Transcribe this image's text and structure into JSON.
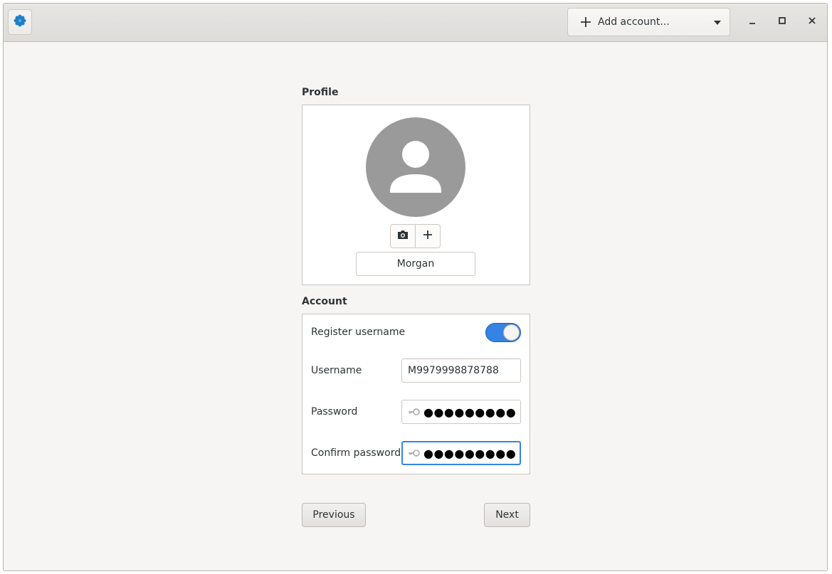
{
  "header": {
    "add_account_label": "Add account...",
    "icons": {
      "app": "app-cog-icon",
      "add": "plus-icon",
      "dropdown": "chevron-down-icon",
      "minimize": "minimize-icon",
      "maximize": "maximize-icon",
      "close": "close-icon"
    }
  },
  "profile": {
    "section_title": "Profile",
    "name_value": "Morgan",
    "icons": {
      "avatar": "user-icon",
      "camera": "camera-icon",
      "add_avatar": "plus-icon"
    }
  },
  "account": {
    "section_title": "Account",
    "register_label": "Register username",
    "register_enabled": true,
    "username_label": "Username",
    "username_value": "M9979998878788",
    "password_label": "Password",
    "password_value": "●●●●●●●●●",
    "confirm_label": "Confirm password",
    "confirm_value": "●●●●●●●●●",
    "icons": {
      "password": "key-icon"
    }
  },
  "footer": {
    "previous_label": "Previous",
    "next_label": "Next"
  },
  "colors": {
    "accent": "#3584e4",
    "app_icon": "#1e7fc8",
    "background": "#f6f5f4"
  }
}
